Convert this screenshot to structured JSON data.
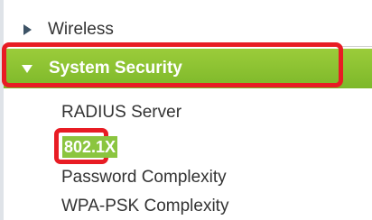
{
  "nav": {
    "wireless": {
      "label": "Wireless",
      "icon": "triangle-right-icon"
    },
    "system_security": {
      "label": "System Security",
      "icon": "triangle-down-icon",
      "background": "#8bc53f",
      "highlight_color": "#e81c24",
      "items": [
        {
          "label": "RADIUS Server"
        },
        {
          "label": "802.1X",
          "selected": true
        },
        {
          "label": "Password Complexity"
        },
        {
          "label": "WPA-PSK Complexity"
        }
      ]
    }
  }
}
